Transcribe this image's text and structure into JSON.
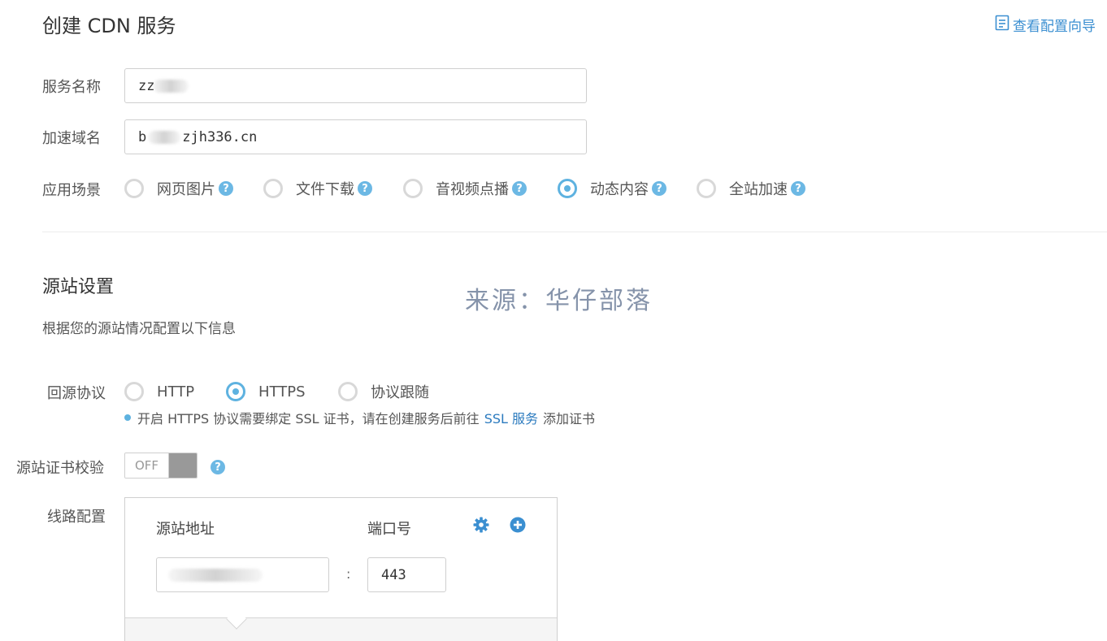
{
  "header": {
    "title": "创建 CDN 服务",
    "guide_link": "查看配置向导",
    "guide_icon": "document-icon"
  },
  "form": {
    "service_name": {
      "label": "服务名称",
      "value_visible": "zz"
    },
    "domain": {
      "label": "加速域名",
      "value_prefix": "b",
      "value_suffix": "zjh336.cn"
    },
    "scenario": {
      "label": "应用场景",
      "options": [
        "网页图片",
        "文件下载",
        "音视频点播",
        "动态内容",
        "全站加速"
      ],
      "selected": "动态内容"
    }
  },
  "origin": {
    "title": "源站设置",
    "description": "根据您的源站情况配置以下信息",
    "watermark": "来源：华仔部落",
    "protocol": {
      "label": "回源协议",
      "options": [
        "HTTP",
        "HTTPS",
        "协议跟随"
      ],
      "selected": "HTTPS"
    },
    "hint": {
      "before": "开启 HTTPS 协议需要绑定 SSL 证书，请在创建服务后前往",
      "link": "SSL 服务",
      "after": "添加证书"
    },
    "cert_check": {
      "label": "源站证书校验",
      "toggle_label": "OFF"
    },
    "route": {
      "label": "线路配置",
      "address_label": "源站地址",
      "port_label": "端口号",
      "separator": ":",
      "port_value": "443"
    }
  },
  "colors": {
    "accent": "#5eb2e0",
    "link": "#2c7bbf",
    "watermark": "#8593aa"
  }
}
